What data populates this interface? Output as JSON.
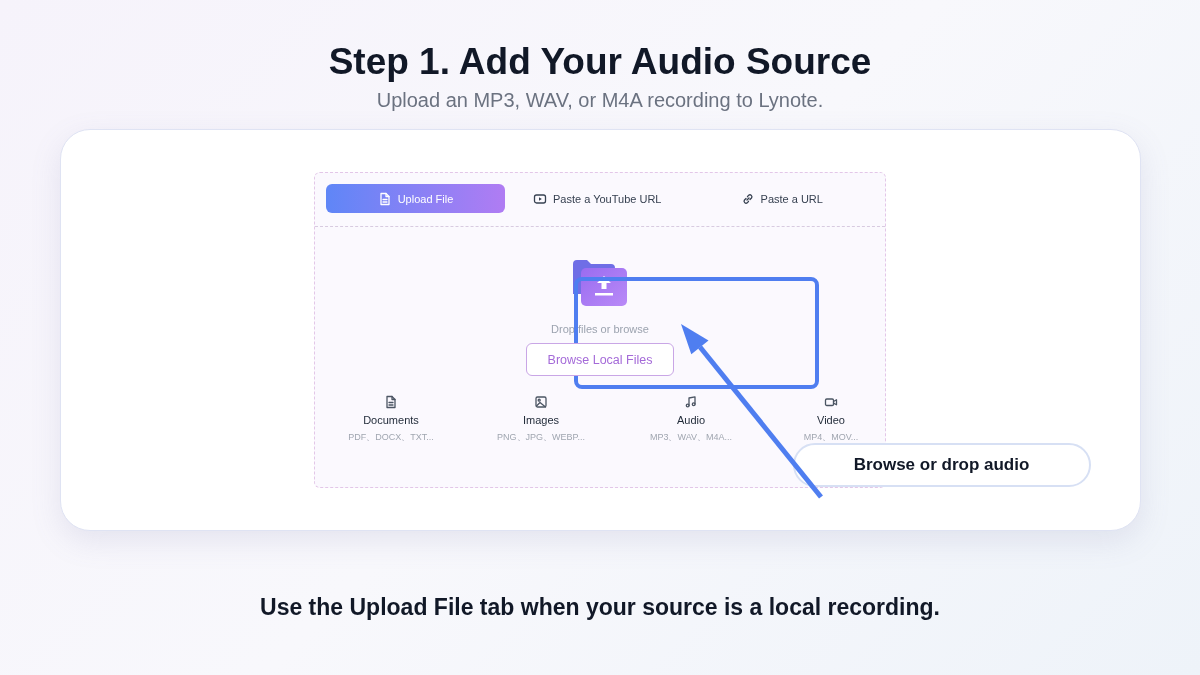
{
  "title": "Step 1. Add Your Audio Source",
  "subtitle": "Upload an MP3, WAV, or M4A recording to Lynote.",
  "uploader": {
    "tabs": [
      {
        "label": "Upload File",
        "kind": "file",
        "selected": true
      },
      {
        "label": "Paste a YouTube URL",
        "kind": "youtube",
        "selected": false
      },
      {
        "label": "Paste a URL",
        "kind": "link",
        "selected": false
      }
    ],
    "drop_hint": "Drop files or browse",
    "browse_button": "Browse Local Files",
    "categories": [
      {
        "kind": "document",
        "label": "Documents",
        "formats": "PDF、DOCX、TXT..."
      },
      {
        "kind": "image",
        "label": "Images",
        "formats": "PNG、JPG、WEBP..."
      },
      {
        "kind": "audio",
        "label": "Audio",
        "formats": "MP3、WAV、M4A..."
      },
      {
        "kind": "video",
        "label": "Video",
        "formats": "MP4、MOV..."
      }
    ]
  },
  "callout": "Browse or drop audio",
  "caption": "Use the Upload File tab when your source is a local recording."
}
